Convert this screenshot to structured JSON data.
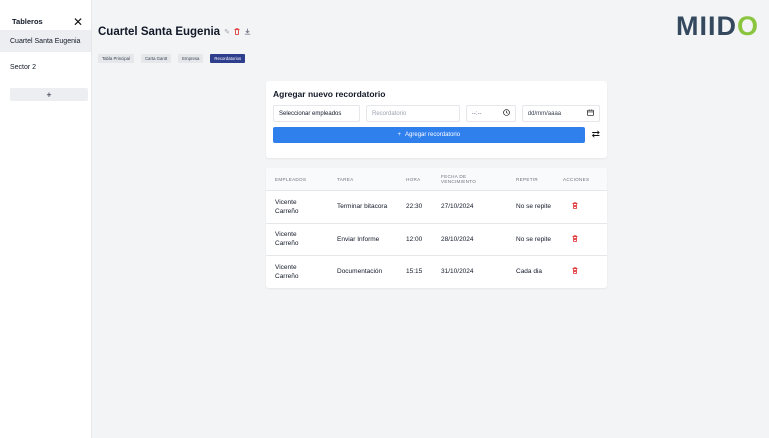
{
  "sidebar": {
    "title": "Tableros",
    "close_icon": "close-icon",
    "items": [
      {
        "label": "Cuartel Santa Eugenia",
        "active": true
      },
      {
        "label": "Sector 2",
        "active": false
      }
    ],
    "add_label": "+"
  },
  "header": {
    "title": "Cuartel Santa Eugenia",
    "icons": [
      "pencil-icon",
      "trash-icon",
      "download-icon"
    ]
  },
  "logo": {
    "text_main": "MIID",
    "text_accent": "O",
    "colors": {
      "main": "#34495e",
      "accent": "#8bc53f"
    }
  },
  "tabs": [
    {
      "label": "Tabla Principal",
      "active": false
    },
    {
      "label": "Carta Gantt",
      "active": false
    },
    {
      "label": "Empresa",
      "active": false
    },
    {
      "label": "Recordatorios",
      "active": true
    }
  ],
  "form": {
    "title": "Agregar nuevo recordatorio",
    "employees_value": "Seleccionar empleados",
    "reminder_placeholder": "Recordatorio",
    "time_value": "--:--",
    "date_value": "dd/mm/aaaa",
    "submit_label": "Agregar recordatorio",
    "submit_color": "#2f7fec"
  },
  "table": {
    "headers": {
      "employees": "EMPLEADOS",
      "task": "TAREA",
      "time": "HORA",
      "due_line1": "FECHA DE",
      "due_line2": "VENCIMIENTO",
      "repeat": "REPETIR",
      "actions": "ACCIONES"
    },
    "rows": [
      {
        "emp1": "Vicente",
        "emp2": "Carreño",
        "task": "Terminar bitacora",
        "time": "22:30",
        "due": "27/10/2024",
        "repeat": "No se repite"
      },
      {
        "emp1": "Vicente",
        "emp2": "Carreño",
        "task": "Enviar Informe",
        "time": "12:00",
        "due": "28/10/2024",
        "repeat": "No se repite"
      },
      {
        "emp1": "Vicente",
        "emp2": "Carreño",
        "task": "Documentación",
        "time": "15:15",
        "due": "31/10/2024",
        "repeat": "Cada dia"
      }
    ]
  }
}
